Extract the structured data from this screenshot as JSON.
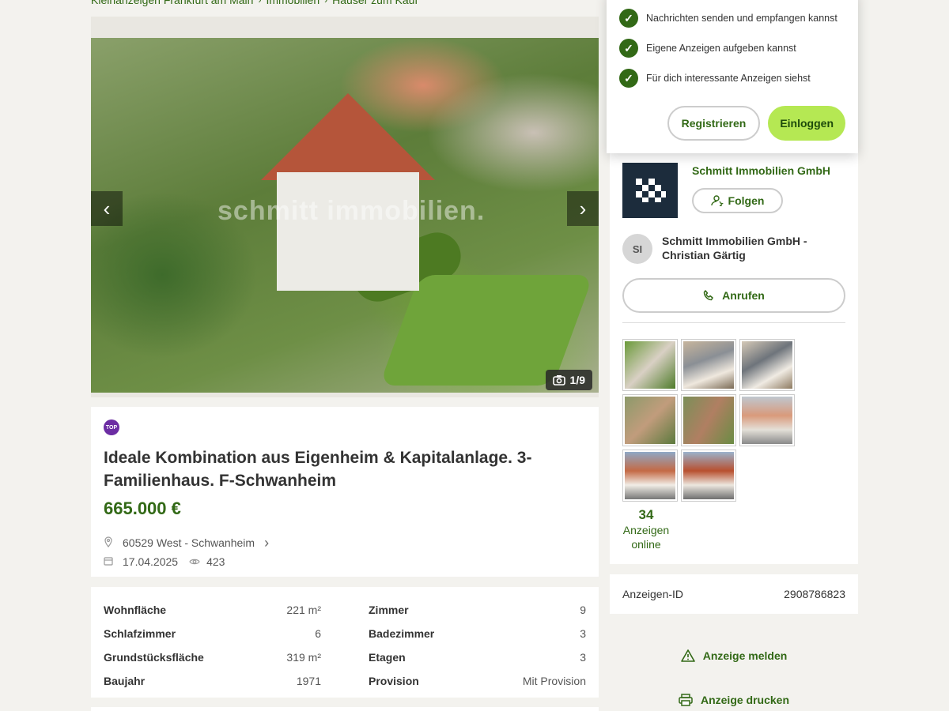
{
  "breadcrumb": {
    "items": [
      "Kleinanzeigen Frankfurt am Main",
      "Immobilien",
      "Häuser zum Kauf"
    ]
  },
  "gallery": {
    "counter": "1/9",
    "watermark": "schmitt immobilien.",
    "prev_icon": "chevron-left-icon",
    "next_icon": "chevron-right-icon",
    "camera_icon": "camera-icon"
  },
  "listing": {
    "badge": "TOP",
    "title": "Ideale Kombination aus Eigenheim & Kapitalanlage. 3-Familienhaus. F-Schwanheim",
    "price": "665.000 €",
    "location": "60529 West - Schwanheim",
    "date": "17.04.2025",
    "views": "423"
  },
  "details": {
    "left": [
      {
        "label": "Wohnfläche",
        "value": "221 m²"
      },
      {
        "label": "Schlafzimmer",
        "value": "6"
      },
      {
        "label": "Grundstücksfläche",
        "value": "319 m²"
      },
      {
        "label": "Baujahr",
        "value": "1971"
      }
    ],
    "right": [
      {
        "label": "Zimmer",
        "value": "9"
      },
      {
        "label": "Badezimmer",
        "value": "3"
      },
      {
        "label": "Etagen",
        "value": "3"
      },
      {
        "label": "Provision",
        "value": "Mit Provision"
      }
    ]
  },
  "login_popup": {
    "benefits": [
      "Nachrichten senden und empfangen kannst",
      "Eigene Anzeigen aufgeben kannst",
      "Für dich interessante Anzeigen siehst"
    ],
    "register_label": "Registrieren",
    "login_label": "Einloggen"
  },
  "seller": {
    "company": "Schmitt Immobilien GmbH",
    "follow_label": "Folgen",
    "avatar_initials": "SI",
    "contact_name": "Schmitt Immobilien GmbH - Christian Gärtig",
    "call_label": "Anrufen",
    "ads_count": "34",
    "ads_label": "Anzeigen online"
  },
  "ad_id": {
    "label": "Anzeigen-ID",
    "value": "2908786823"
  },
  "actions": {
    "report_label": "Anzeige melden",
    "print_label": "Anzeige drucken"
  },
  "colors": {
    "accent_green": "#326916",
    "login_button": "#b5e853",
    "top_badge": "#6c2da3",
    "background": "#f3f2ee"
  }
}
